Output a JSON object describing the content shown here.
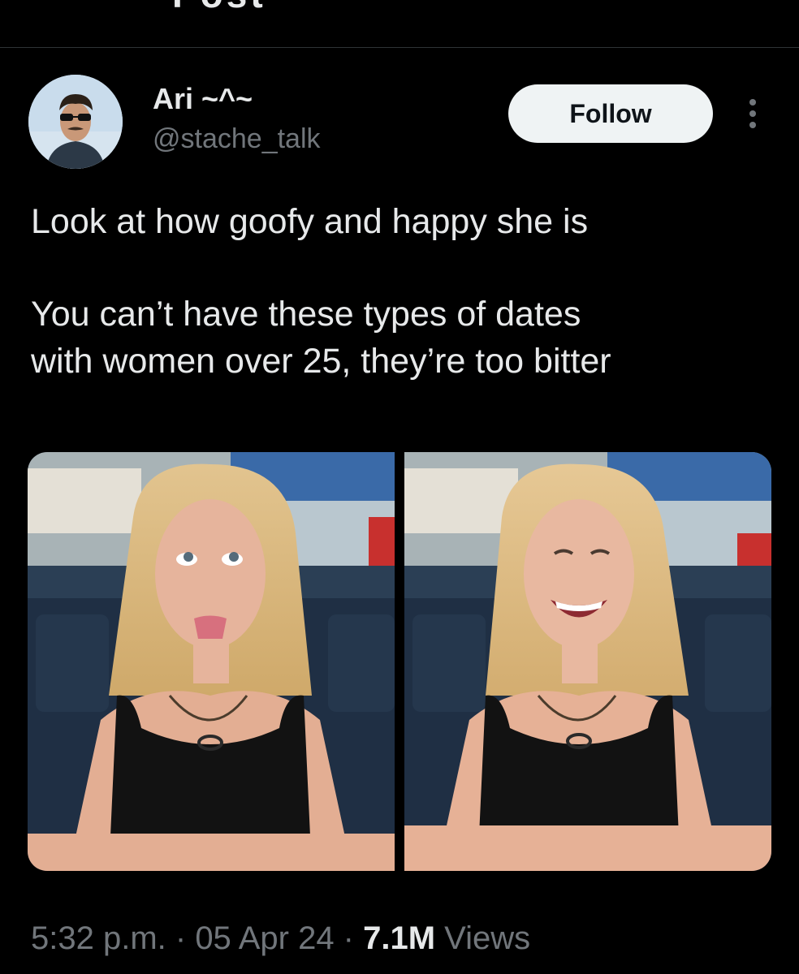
{
  "header": {
    "title_fragment": "Post"
  },
  "author": {
    "name": "Ari ~^~",
    "handle": "@stache_talk",
    "avatar_icon": "user-avatar"
  },
  "actions": {
    "follow_label": "Follow",
    "more_icon": "more-vertical-icon"
  },
  "tweet": {
    "line1": "Look at how goofy and happy she is",
    "line2": "You can’t have these types of dates",
    "line3": "with women over 25, they’re too bitter"
  },
  "media": {
    "photo_count": 2,
    "items": [
      "woman-tongue-out-photo",
      "woman-smiling-photo"
    ]
  },
  "meta": {
    "time": "5:32 p.m.",
    "sep1": " · ",
    "date": "05 Apr 24",
    "sep2": " · ",
    "views_count": "7.1M",
    "views_label": " Views"
  },
  "colors": {
    "background": "#000000",
    "text_primary": "#e7e9ea",
    "text_secondary": "#71767b",
    "button_bg": "#eff3f4",
    "button_text": "#0f1419"
  }
}
